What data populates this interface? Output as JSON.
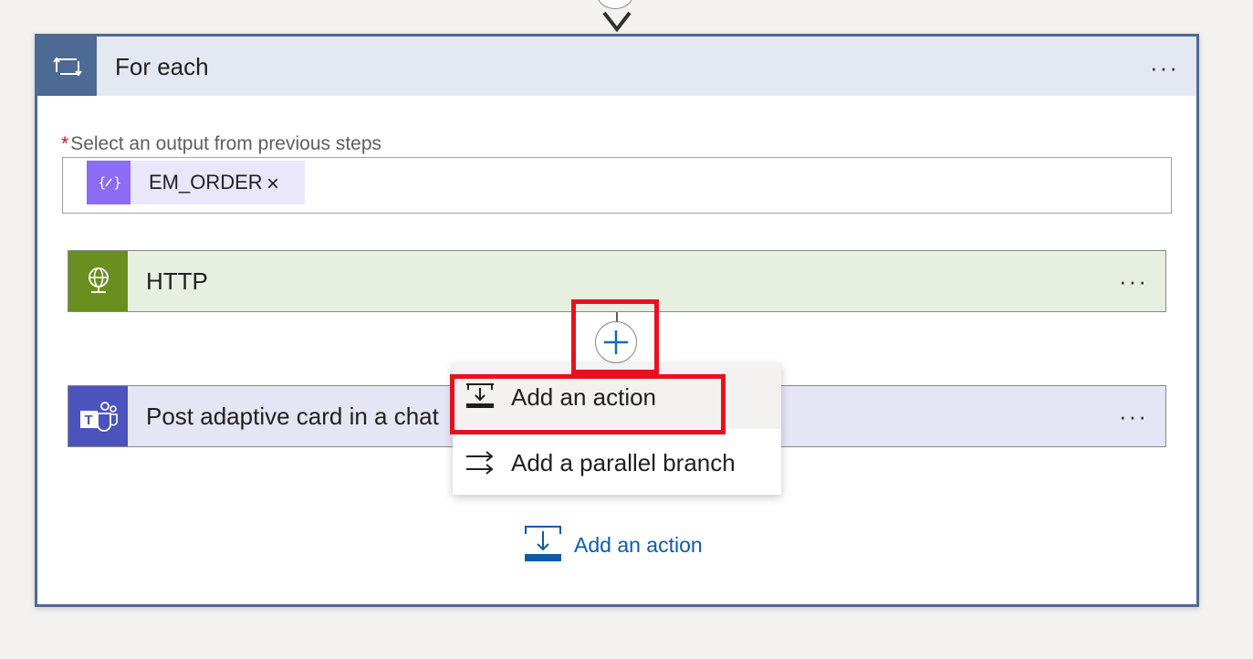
{
  "foreach": {
    "title": "For each",
    "more_label": "···",
    "field_label": "Select an output from previous steps",
    "required_marker": "*",
    "token": {
      "text": "EM_ORDER",
      "remove_label": "×"
    }
  },
  "actions": [
    {
      "title": "HTTP",
      "more_label": "···",
      "accent": "#6b8f1f"
    },
    {
      "title": "Post adaptive card in a chat",
      "more_label": "···",
      "accent": "#4b53bc"
    }
  ],
  "menu": {
    "items": [
      {
        "label": "Add an action"
      },
      {
        "label": "Add a parallel branch"
      }
    ]
  },
  "bottom": {
    "add_action_label": "Add an action"
  },
  "colors": {
    "foreach_accent": "#4c6a93",
    "highlight": "#e8101e",
    "link": "#0f5aa8"
  }
}
